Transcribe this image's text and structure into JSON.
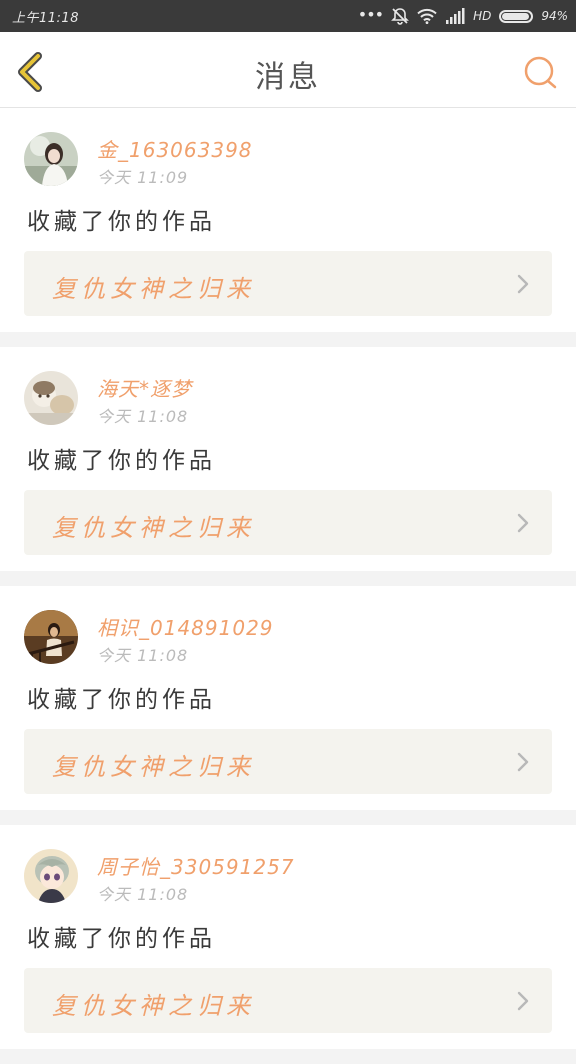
{
  "status_bar": {
    "time": "上午11:18",
    "network": "HD",
    "battery_percent": "94%",
    "battery_level": 0.94
  },
  "header": {
    "title": "消息",
    "back_icon": "chevron-left-icon",
    "search_icon": "search-icon"
  },
  "colors": {
    "accent": "#f0a06c",
    "back_icon": "#e6c437"
  },
  "messages": [
    {
      "username": "金_163063398",
      "time": "今天 11:09",
      "action": "收藏了你的作品",
      "work_title": "复仇女神之归来",
      "avatar": "avatar-girl-in-white"
    },
    {
      "username": "海天*逐梦",
      "time": "今天 11:08",
      "action": "收藏了你的作品",
      "work_title": "复仇女神之归来",
      "avatar": "avatar-child-with-dog"
    },
    {
      "username": "相识_014891029",
      "time": "今天 11:08",
      "action": "收藏了你的作品",
      "work_title": "复仇女神之归来",
      "avatar": "avatar-girl-on-stairs"
    },
    {
      "username": "周子怡_330591257",
      "time": "今天 11:08",
      "action": "收藏了你的作品",
      "work_title": "复仇女神之归来",
      "avatar": "avatar-anime-boy"
    }
  ]
}
